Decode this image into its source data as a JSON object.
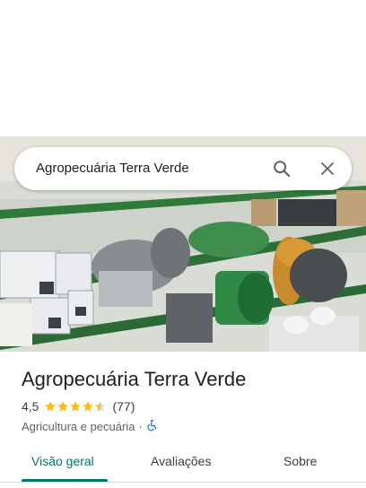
{
  "search": {
    "query": "Agropecuária Terra Verde"
  },
  "place": {
    "name": "Agropecuária Terra Verde",
    "rating": "4,5",
    "rating_value": 4.5,
    "review_count": "(77)",
    "category": "Agricultura e pecuária",
    "separator": "·"
  },
  "icons": [
    "search-icon",
    "close-icon",
    "star-icon",
    "wheelchair-icon"
  ],
  "tabs": [
    {
      "label": "Visão geral",
      "active": true
    },
    {
      "label": "Avaliações",
      "active": false
    },
    {
      "label": "Sobre",
      "active": false
    }
  ],
  "colors": {
    "accent": "#00796b",
    "star": "#fbbc04",
    "accessibility": "#1a73e8"
  }
}
